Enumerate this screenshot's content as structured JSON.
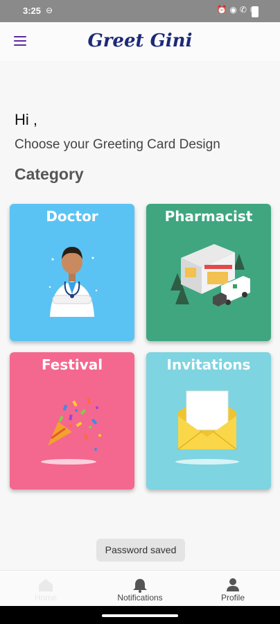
{
  "status_bar": {
    "time": "3:25",
    "sync_icon": "sync-circle-icon",
    "right_icons": [
      "alarm-icon",
      "eye-icon",
      "wifi-call-icon",
      "wifi-icon",
      "battery-icon"
    ]
  },
  "app_bar": {
    "title": "Greet Gini",
    "menu_icon": "hamburger-menu-icon"
  },
  "main": {
    "greeting": "Hi ,",
    "subtitle": "Choose your Greeting Card Design",
    "category_heading": "Category"
  },
  "categories": [
    {
      "label": "Doctor",
      "color": "#5bc3f3",
      "icon": "doctor-illustration"
    },
    {
      "label": "Pharmacist",
      "color": "#3fa680",
      "icon": "pharmacy-illustration"
    },
    {
      "label": "Festival",
      "color": "#f4678e",
      "icon": "party-popper-illustration"
    },
    {
      "label": "Invitations",
      "color": "#7ed4e0",
      "icon": "envelope-illustration"
    }
  ],
  "toast": {
    "text": "Password saved"
  },
  "bottom_nav": {
    "items": [
      {
        "label": "Home",
        "icon": "home-icon",
        "active": false
      },
      {
        "label": "Notifications",
        "icon": "bell-icon",
        "active": false
      },
      {
        "label": "Profile",
        "icon": "person-icon",
        "active": false
      }
    ]
  },
  "colors": {
    "accent": "#5a2a9a",
    "title": "#1d2a78",
    "background": "#f7f7f7"
  }
}
